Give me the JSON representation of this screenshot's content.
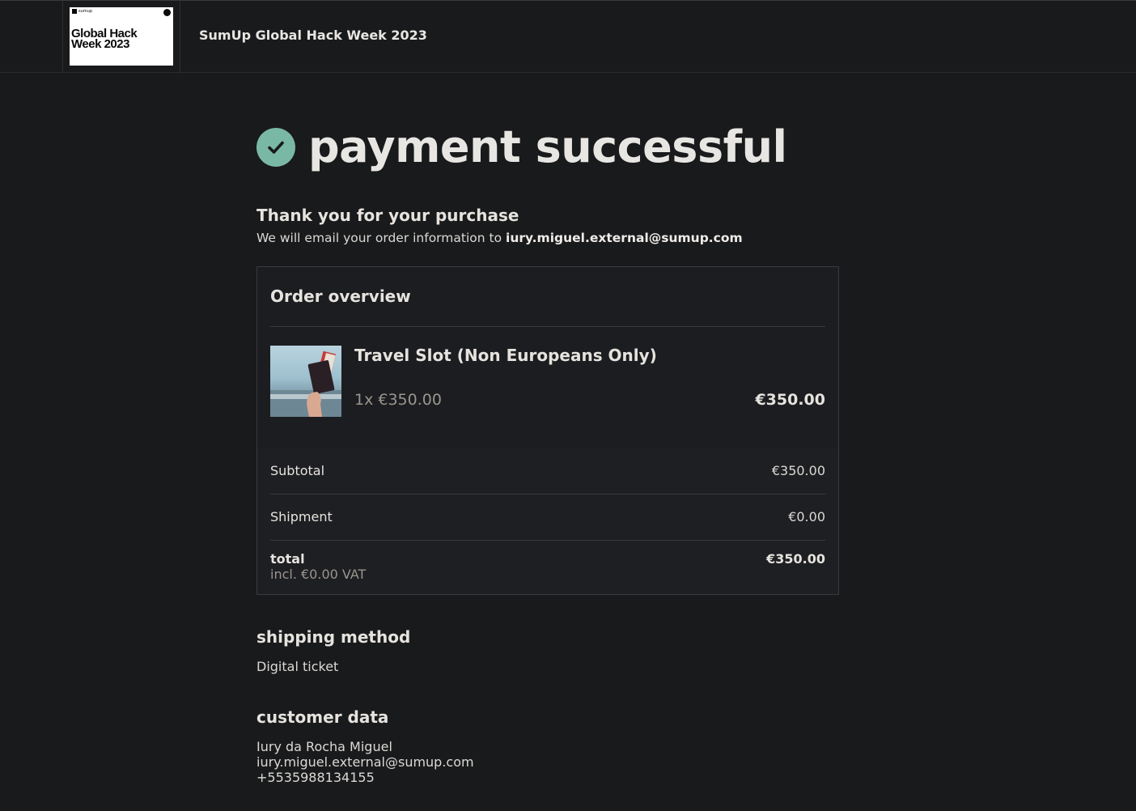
{
  "header": {
    "logo_brand": "sumup",
    "logo_text": "Global Hack\nWeek 2023",
    "site_title": "SumUp Global Hack Week 2023"
  },
  "status": {
    "title": "payment successful",
    "check_color": "#7ab8a6"
  },
  "thanks": {
    "heading": "Thank you for your purchase",
    "email_prefix": "We will email your order information to ",
    "email": "iury.miguel.external@sumup.com"
  },
  "order": {
    "heading": "Order overview",
    "item": {
      "name": "Travel Slot (Non Europeans Only)",
      "qty_price": "1x €350.00",
      "line_total": "€350.00"
    },
    "subtotal_label": "Subtotal",
    "subtotal_value": "€350.00",
    "shipment_label": "Shipment",
    "shipment_value": "€0.00",
    "total_label": "total",
    "total_value": "€350.00",
    "vat_note": "incl. €0.00 VAT"
  },
  "shipping": {
    "heading": "shipping method",
    "value": "Digital ticket"
  },
  "customer": {
    "heading": "customer data",
    "name": "Iury da Rocha Miguel",
    "email": "iury.miguel.external@sumup.com",
    "phone": "+5535988134155"
  }
}
